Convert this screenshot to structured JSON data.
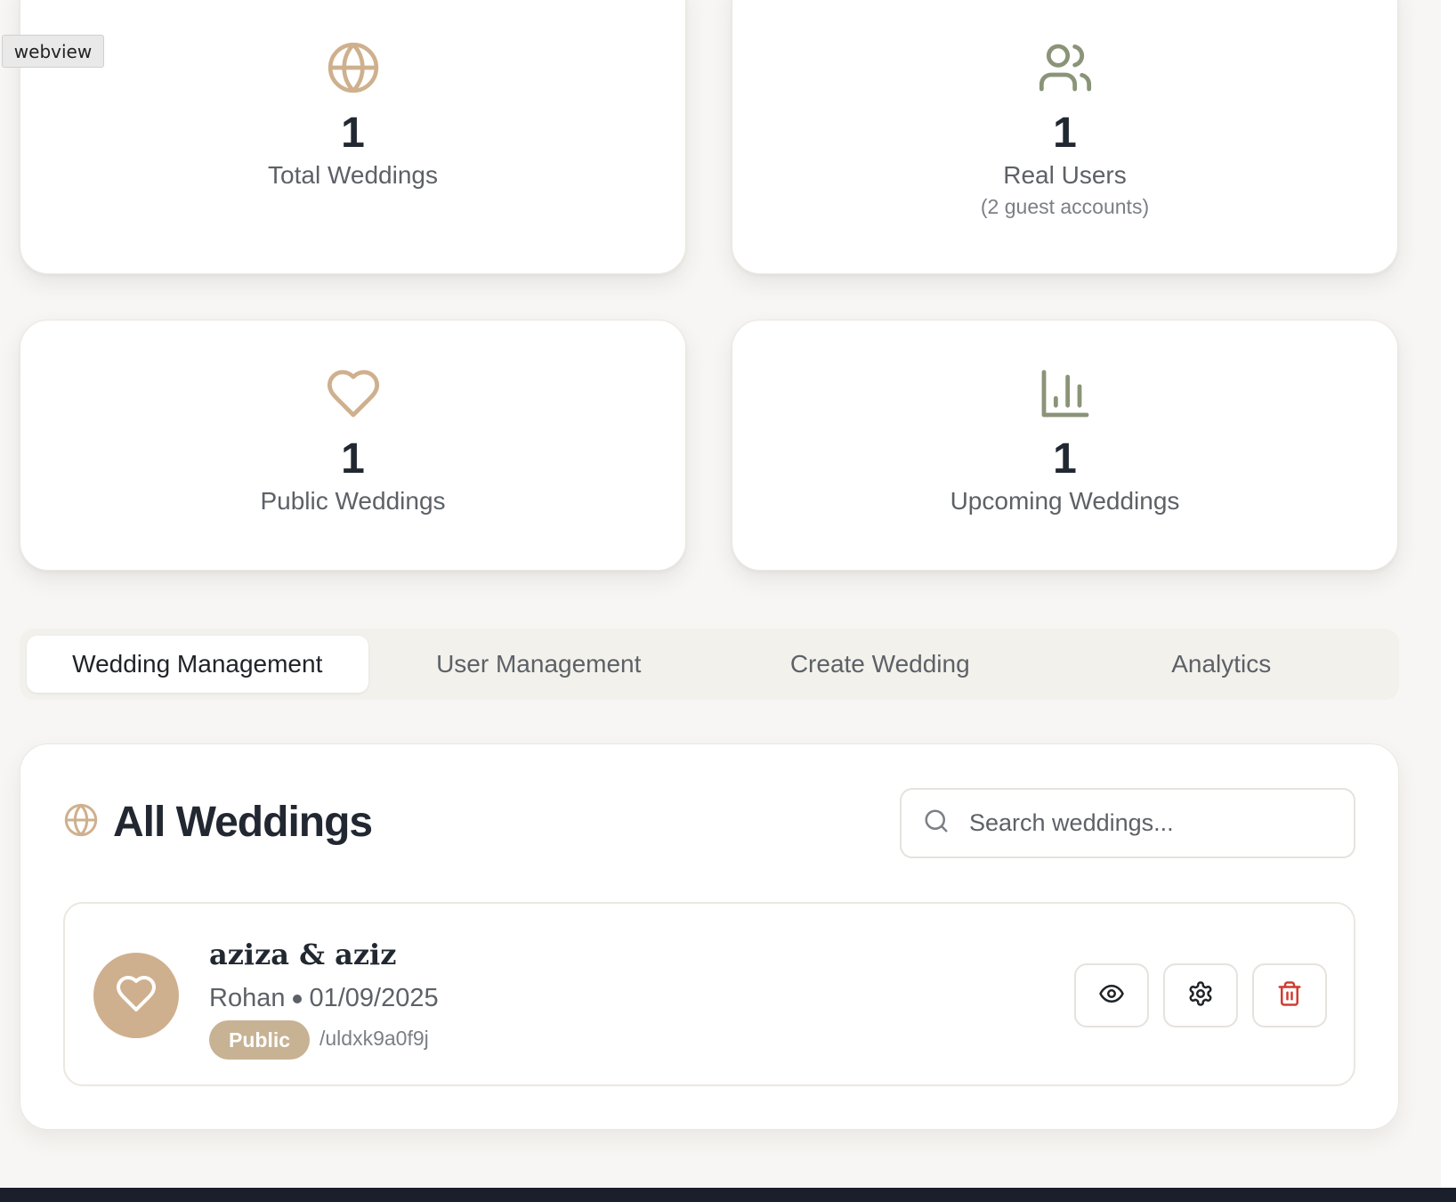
{
  "overlay": {
    "webview_label": "webview"
  },
  "stats": [
    {
      "value": "1",
      "label": "Total Weddings",
      "icon": "globe-icon"
    },
    {
      "value": "1",
      "label": "Real Users",
      "sub": "(2 guest accounts)",
      "icon": "users-icon"
    },
    {
      "value": "1",
      "label": "Public Weddings",
      "icon": "heart-icon"
    },
    {
      "value": "1",
      "label": "Upcoming Weddings",
      "icon": "bar-chart-icon"
    }
  ],
  "tabs": [
    {
      "label": "Wedding Management",
      "active": true
    },
    {
      "label": "User Management"
    },
    {
      "label": "Create Wedding"
    },
    {
      "label": "Analytics"
    }
  ],
  "panel": {
    "title": "All Weddings",
    "search_placeholder": "Search weddings..."
  },
  "weddings": [
    {
      "name": "aziza & aziz",
      "owner": "Rohan",
      "date": "01/09/2025",
      "visibility": "Public",
      "slug": "/uldxk9a0f9j"
    }
  ],
  "colors": {
    "accent_tan": "#cfb08e",
    "accent_sage": "#8a9478",
    "badge": "#c7b293",
    "danger": "#d23b30",
    "background": "#f8f6f4"
  }
}
